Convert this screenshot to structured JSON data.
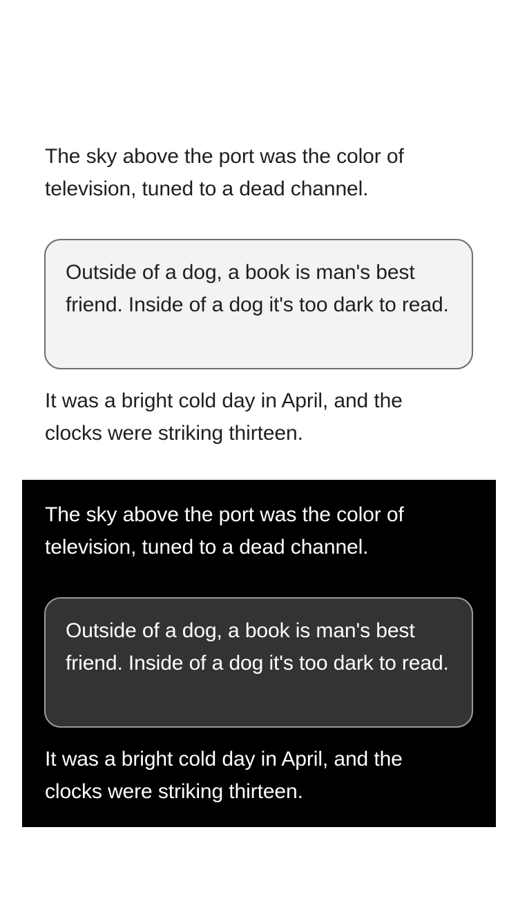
{
  "light": {
    "paragraph_top": "The sky above the port was the color of television, tuned to a dead channel.",
    "card_text": "Outside of a dog, a book is man's best friend. Inside of a dog it's too dark to read.",
    "paragraph_bottom": "It was a bright cold day in April, and the clocks were striking thirteen."
  },
  "dark": {
    "paragraph_top": "The sky above the port was the color of television, tuned to a dead channel.",
    "card_text": "Outside of a dog, a book is man's best friend. Inside of a dog it's too dark to read.",
    "paragraph_bottom": "It was a bright cold day in April, and the clocks were striking thirteen."
  },
  "colors": {
    "light_background": "#ffffff",
    "light_text": "#1f1f21",
    "light_card_background": "#f3f3f5",
    "light_card_border": "#6e6e70",
    "dark_background": "#000000",
    "dark_text": "#ffffff",
    "dark_card_background": "#333333",
    "dark_card_border": "#9a9a9c"
  }
}
